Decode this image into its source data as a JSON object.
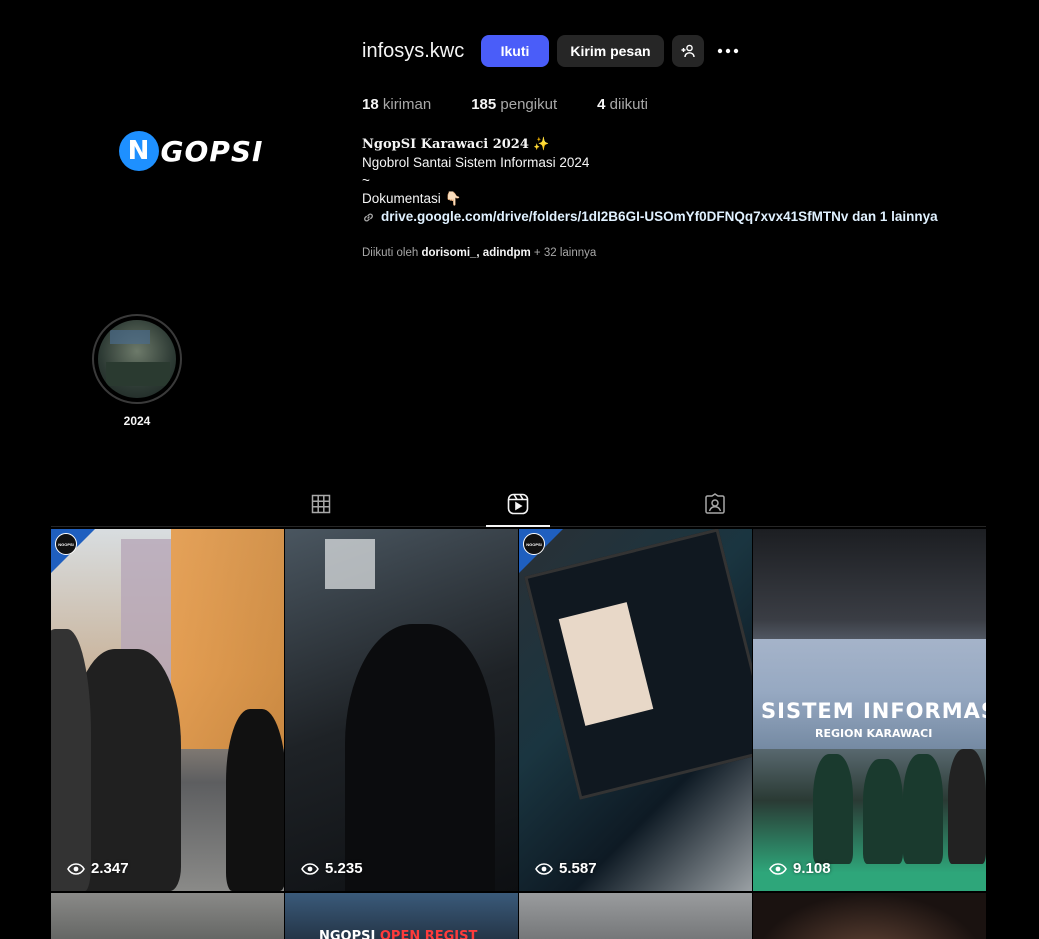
{
  "profile": {
    "username": "infosys.kwc",
    "follow_label": "Ikuti",
    "message_label": "Kirim pesan",
    "avatar_text": "GOPSI",
    "avatar_mark": "N"
  },
  "stats": [
    {
      "num": "18",
      "label": "kiriman"
    },
    {
      "num": "185",
      "label": "pengikut"
    },
    {
      "num": "4",
      "label": "diikuti"
    }
  ],
  "bio": {
    "name": "NgopSI Karawaci 2024 ✨",
    "line1": "Ngobrol Santai Sistem Informasi 2024",
    "line2": "~",
    "line3": "Dokumentasi 👇🏻",
    "link": "drive.google.com/drive/folders/1dI2B6GI-USOmYf0DFNQq7xvx41SfMTNv dan 1 lainnya"
  },
  "followed_by": {
    "prefix": "Diikuti oleh",
    "users": "dorisomi_, adindpm",
    "suffix": "+ 32 lainnya"
  },
  "highlight": {
    "label": "2024"
  },
  "tabs": {
    "active": "reels"
  },
  "reels": [
    {
      "views": "2.347"
    },
    {
      "views": "5.235"
    },
    {
      "views": "5.587"
    },
    {
      "views": "9.108"
    }
  ],
  "tile_texts": {
    "stage_title": "SISTEM INFORMASI",
    "stage_sub": "REGION KARAWACI",
    "open_regist_a": "NGOPSI",
    "open_regist_b": "OPEN REGIST",
    "badge_logo": "NGOPSI"
  },
  "colors": {
    "accent": "#4a5df9",
    "background": "#000000",
    "button_dark": "#262626"
  }
}
